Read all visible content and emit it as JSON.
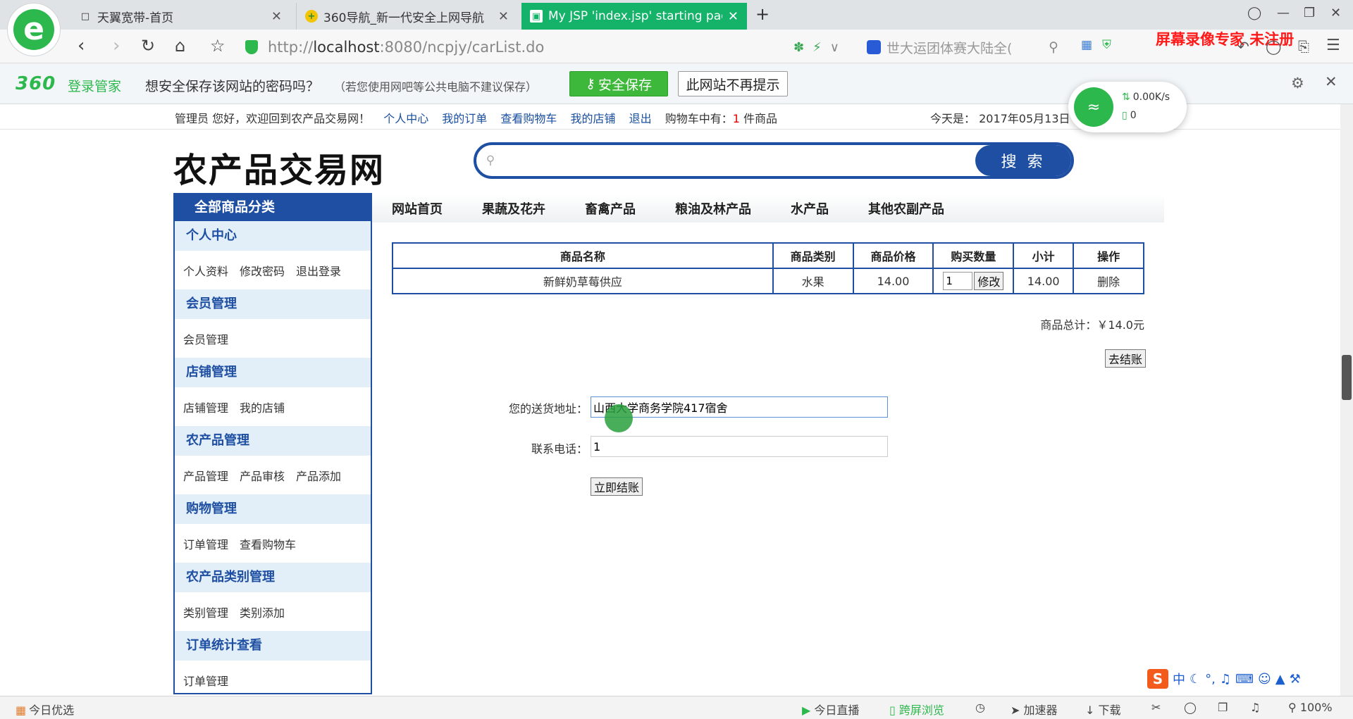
{
  "browser": {
    "logo_letter": "e",
    "tabs": [
      {
        "title": "天翼宽带-首页",
        "icon": "page-icon"
      },
      {
        "title": "360导航_新一代安全上网导航",
        "icon": "navigation-icon"
      },
      {
        "title": "My JSP 'index.jsp' starting pag",
        "icon": "image-icon",
        "active": true
      }
    ],
    "address": {
      "scheme_host_muted": "http://",
      "host": "localhost",
      "rest": ":8080/ncpjy/carList.do"
    },
    "search_text": "世大运团体赛大陆全(",
    "watermark": "屏幕录像专家 未注册"
  },
  "password_bar": {
    "logo": "360",
    "brand": "登录管家",
    "question": "想安全保存该网站的密码吗？",
    "note": "（若您使用网吧等公共电脑不建议保存）",
    "save_label": "安全保存",
    "never_label": "此网站不再提示"
  },
  "speed_widget": {
    "up": "0.00K/s",
    "down": "0"
  },
  "site": {
    "welcome": "管理员 您好，欢迎回到农产品交易网！",
    "links": [
      "个人中心",
      "我的订单",
      "查看购物车",
      "我的店铺",
      "退出"
    ],
    "cart_prefix": "购物车中有：",
    "cart_count": "1",
    "cart_suffix": " 件商品",
    "today": "今天是： 2017年05月13日",
    "logo": "农产品交易网",
    "search_button": "搜 索"
  },
  "sidebar": {
    "header": "全部商品分类",
    "groups": [
      {
        "title": "个人中心",
        "links": [
          "个人资料",
          "修改密码",
          "退出登录"
        ]
      },
      {
        "title": "会员管理",
        "links": [
          "会员管理"
        ]
      },
      {
        "title": "店铺管理",
        "links": [
          "店铺管理",
          "我的店铺"
        ]
      },
      {
        "title": "农产品管理",
        "links": [
          "产品管理",
          "产品审核",
          "产品添加"
        ]
      },
      {
        "title": "购物管理",
        "links": [
          "订单管理",
          "查看购物车"
        ]
      },
      {
        "title": "农产品类别管理",
        "links": [
          "类别管理",
          "类别添加"
        ]
      },
      {
        "title": "订单统计查看",
        "links": [
          "订单管理"
        ]
      }
    ]
  },
  "category_nav": [
    "网站首页",
    "果蔬及花卉",
    "畜禽产品",
    "粮油及林产品",
    "水产品",
    "其他农副产品"
  ],
  "cart": {
    "headers": [
      "商品名称",
      "商品类别",
      "商品价格",
      "购买数量",
      "小计",
      "操作"
    ],
    "rows": [
      {
        "name": "新鲜奶草莓供应",
        "category": "水果",
        "price": "14.00",
        "qty": "1",
        "modify": "修改",
        "subtotal": "14.00",
        "action": "删除"
      }
    ],
    "total": "商品总计：￥14.0元",
    "checkout_label": "去结账"
  },
  "checkout_form": {
    "address_label": "您的送货地址：",
    "address_value": "山西大学商务学院417宿舍",
    "phone_label": "联系电话：",
    "phone_value": "1",
    "pay_label": "立即结账"
  },
  "ime": {
    "logo": "S",
    "mode": "中"
  },
  "statusbar": {
    "today_pick": "今日优选",
    "live": "今日直播",
    "cross_screen": "跨屏浏览",
    "accelerator": "加速器",
    "download": "下载",
    "zoom": "100%"
  }
}
